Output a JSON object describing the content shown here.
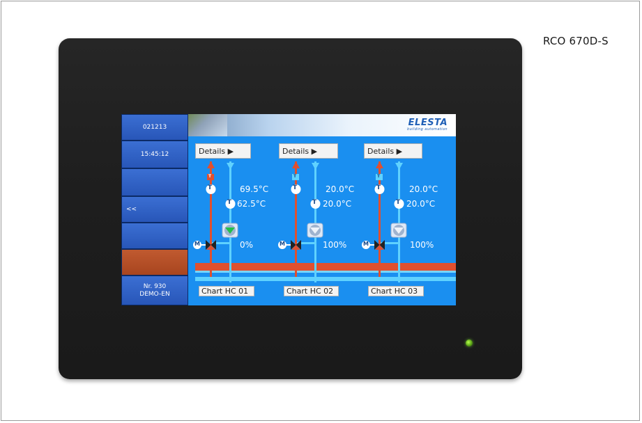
{
  "model": "RCO 670D-S",
  "sidebar": {
    "date": "021213",
    "time": "15:45:12",
    "back": "<<",
    "footer_line1": "Nr. 930",
    "footer_line2": "DEMO-EN"
  },
  "logo": {
    "name": "ELESTA",
    "tagline": "building automation"
  },
  "circuits": [
    {
      "details": "Details ▶",
      "supply_temp": "69.5°C",
      "return_temp": "62.5°C",
      "valve": "0%",
      "chart": "Chart HC 01",
      "pump_state": "on"
    },
    {
      "details": "Details ▶",
      "supply_temp": "20.0°C",
      "return_temp": "20.0°C",
      "valve": "100%",
      "chart": "Chart HC 02",
      "pump_state": "off"
    },
    {
      "details": "Details ▶",
      "supply_temp": "20.0°C",
      "return_temp": "20.0°C",
      "valve": "100%",
      "chart": "Chart HC 03",
      "pump_state": "off"
    }
  ],
  "symbols": {
    "temp_sensor": "T",
    "motor": "M"
  },
  "colors": {
    "supply": "#e0502f",
    "return": "#5fd2ff",
    "pump_on": "#22c04a",
    "pump_off": "#c9d3e0",
    "accent_orange": "#b6522b"
  }
}
